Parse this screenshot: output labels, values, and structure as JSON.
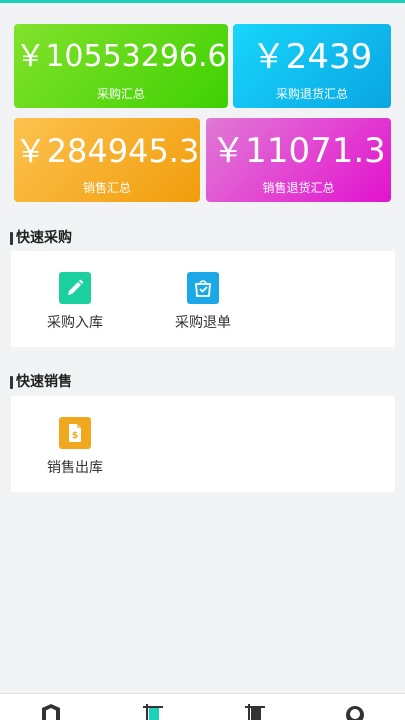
{
  "summary": {
    "purchase": {
      "amount": "￥10553296.6",
      "label": "采购汇总",
      "color": "#3fd103"
    },
    "purchase_return": {
      "amount": "￥2439",
      "label": "采购退货汇总",
      "color": "#0aa5e3"
    },
    "sales": {
      "amount": "￥284945.3",
      "label": "销售汇总",
      "color": "#f19d0c"
    },
    "sales_return": {
      "amount": "￥11071.3",
      "label": "销售退货汇总",
      "color": "#e313cf"
    }
  },
  "quick_purchase": {
    "title": "快速采购",
    "items": [
      {
        "label": "采购入库",
        "icon": "pencil-icon",
        "color": "#1ccf9f"
      },
      {
        "label": "采购退单",
        "icon": "return-bag-icon",
        "color": "#1aa9e6"
      }
    ]
  },
  "quick_sales": {
    "title": "快速销售",
    "items": [
      {
        "label": "销售出库",
        "icon": "dollar-doc-icon",
        "color": "#f0a81e"
      }
    ]
  },
  "tabbar": {
    "tabs": [
      {
        "icon": "home-icon"
      },
      {
        "icon": "purchase-doc-icon"
      },
      {
        "icon": "sales-doc-icon"
      },
      {
        "icon": "profile-icon"
      }
    ]
  }
}
